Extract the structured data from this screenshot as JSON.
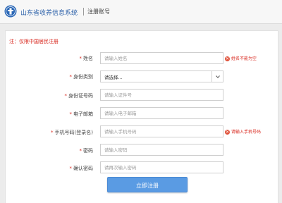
{
  "header": {
    "app_title": "山东省收养信息系统",
    "page_title": "注册账号",
    "logo_icon": "seal-logo-icon",
    "brand_color": "#2a5fa8"
  },
  "notice": "注：仅限中国居民注册",
  "form": {
    "required_mark": "*",
    "fields": [
      {
        "label": "姓名",
        "placeholder": "请输入姓名",
        "error": "姓名不能为空"
      },
      {
        "label": "身份类别",
        "selected": "请选择...",
        "icon": "chevron-down-icon"
      },
      {
        "label": "身份证号码",
        "placeholder": "请输入证件号"
      },
      {
        "label": "电子邮箱",
        "placeholder": "请输入电子邮箱"
      },
      {
        "label": "手机号码(登录名)",
        "placeholder": "请输入手机号码",
        "error": "请输入手机号码"
      },
      {
        "label": "密码",
        "placeholder": "请输入密码"
      },
      {
        "label": "确认密码",
        "placeholder": "请再次输入密码"
      }
    ],
    "error_icon": "error-x-icon",
    "error_color": "#d8261c"
  },
  "submit_label": "立即注册",
  "accent_color": "#5a9be3"
}
